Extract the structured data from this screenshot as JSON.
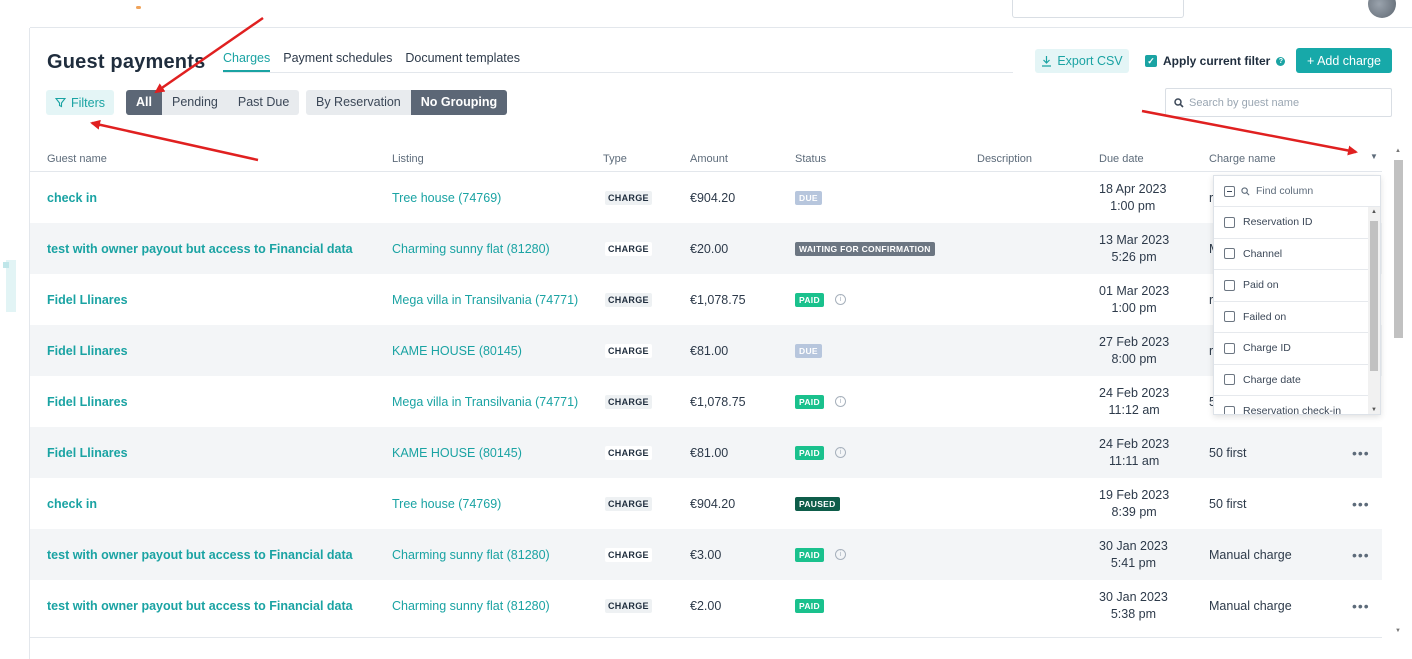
{
  "page": {
    "title": "Guest payments",
    "tabs": [
      {
        "label": "Charges",
        "active": true
      },
      {
        "label": "Payment schedules",
        "active": false
      },
      {
        "label": "Document templates",
        "active": false
      }
    ],
    "export_label": "Export CSV",
    "apply_filter_label": "Apply current filter",
    "apply_filter_checked": true,
    "add_charge_label": "+ Add charge",
    "filters_label": "Filters",
    "status_filters": [
      "All",
      "Pending",
      "Past Due"
    ],
    "status_filter_selected": "All",
    "grouping": [
      "By Reservation",
      "No Grouping"
    ],
    "grouping_selected": "No Grouping",
    "search_placeholder": "Search by guest name"
  },
  "table": {
    "headers": {
      "guest": "Guest name",
      "listing": "Listing",
      "type": "Type",
      "amount": "Amount",
      "status": "Status",
      "description": "Description",
      "due_date": "Due date",
      "charge_name": "Charge name"
    },
    "rows": [
      {
        "guest": "check in",
        "listing": "Tree house (74769)",
        "type": "CHARGE",
        "amount": "€904.20",
        "status": "DUE",
        "status_kind": "due",
        "info": false,
        "date": "18 Apr 2023",
        "time": "1:00 pm",
        "charge": "r"
      },
      {
        "guest": "test with owner payout but access to Financial data",
        "listing": "Charming sunny flat (81280)",
        "type": "CHARGE",
        "amount": "€20.00",
        "status": "WAITING FOR CONFIRMATION",
        "status_kind": "wait",
        "info": false,
        "date": "13 Mar 2023",
        "time": "5:26 pm",
        "charge": "M"
      },
      {
        "guest": "Fidel Llinares",
        "listing": "Mega villa in Transilvania (74771)",
        "type": "CHARGE",
        "amount": "€1,078.75",
        "status": "PAID",
        "status_kind": "paid",
        "info": true,
        "date": "01 Mar 2023",
        "time": "1:00 pm",
        "charge": "r"
      },
      {
        "guest": "Fidel Llinares",
        "listing": "KAME HOUSE (80145)",
        "type": "CHARGE",
        "amount": "€81.00",
        "status": "DUE",
        "status_kind": "due",
        "info": false,
        "date": "27 Feb 2023",
        "time": "8:00 pm",
        "charge": "r"
      },
      {
        "guest": "Fidel Llinares",
        "listing": "Mega villa in Transilvania (74771)",
        "type": "CHARGE",
        "amount": "€1,078.75",
        "status": "PAID",
        "status_kind": "paid",
        "info": true,
        "date": "24 Feb 2023",
        "time": "11:12 am",
        "charge": "5"
      },
      {
        "guest": "Fidel Llinares",
        "listing": "KAME HOUSE (80145)",
        "type": "CHARGE",
        "amount": "€81.00",
        "status": "PAID",
        "status_kind": "paid",
        "info": true,
        "date": "24 Feb 2023",
        "time": "11:11 am",
        "charge": "50 first"
      },
      {
        "guest": "check in",
        "listing": "Tree house (74769)",
        "type": "CHARGE",
        "amount": "€904.20",
        "status": "PAUSED",
        "status_kind": "paused",
        "info": false,
        "date": "19 Feb 2023",
        "time": "8:39 pm",
        "charge": "50 first"
      },
      {
        "guest": "test with owner payout but access to Financial data",
        "listing": "Charming sunny flat (81280)",
        "type": "CHARGE",
        "amount": "€3.00",
        "status": "PAID",
        "status_kind": "paid",
        "info": true,
        "date": "30 Jan 2023",
        "time": "5:41 pm",
        "charge": "Manual charge"
      },
      {
        "guest": "test with owner payout but access to Financial data",
        "listing": "Charming sunny flat (81280)",
        "type": "CHARGE",
        "amount": "€2.00",
        "status": "PAID",
        "status_kind": "paid",
        "info": false,
        "date": "30 Jan 2023",
        "time": "5:38 pm",
        "charge": "Manual charge"
      }
    ]
  },
  "column_menu": {
    "find_placeholder": "Find column",
    "items": [
      "Reservation ID",
      "Channel",
      "Paid on",
      "Failed on",
      "Charge ID",
      "Charge date",
      "Reservation check-in"
    ]
  },
  "colors": {
    "accent": "#17a9a9",
    "paid": "#1ac18d",
    "paused": "#0e5d4a",
    "due": "#b7c6dd",
    "waiting": "#6c7682",
    "annotation_arrow": "#e02020"
  }
}
